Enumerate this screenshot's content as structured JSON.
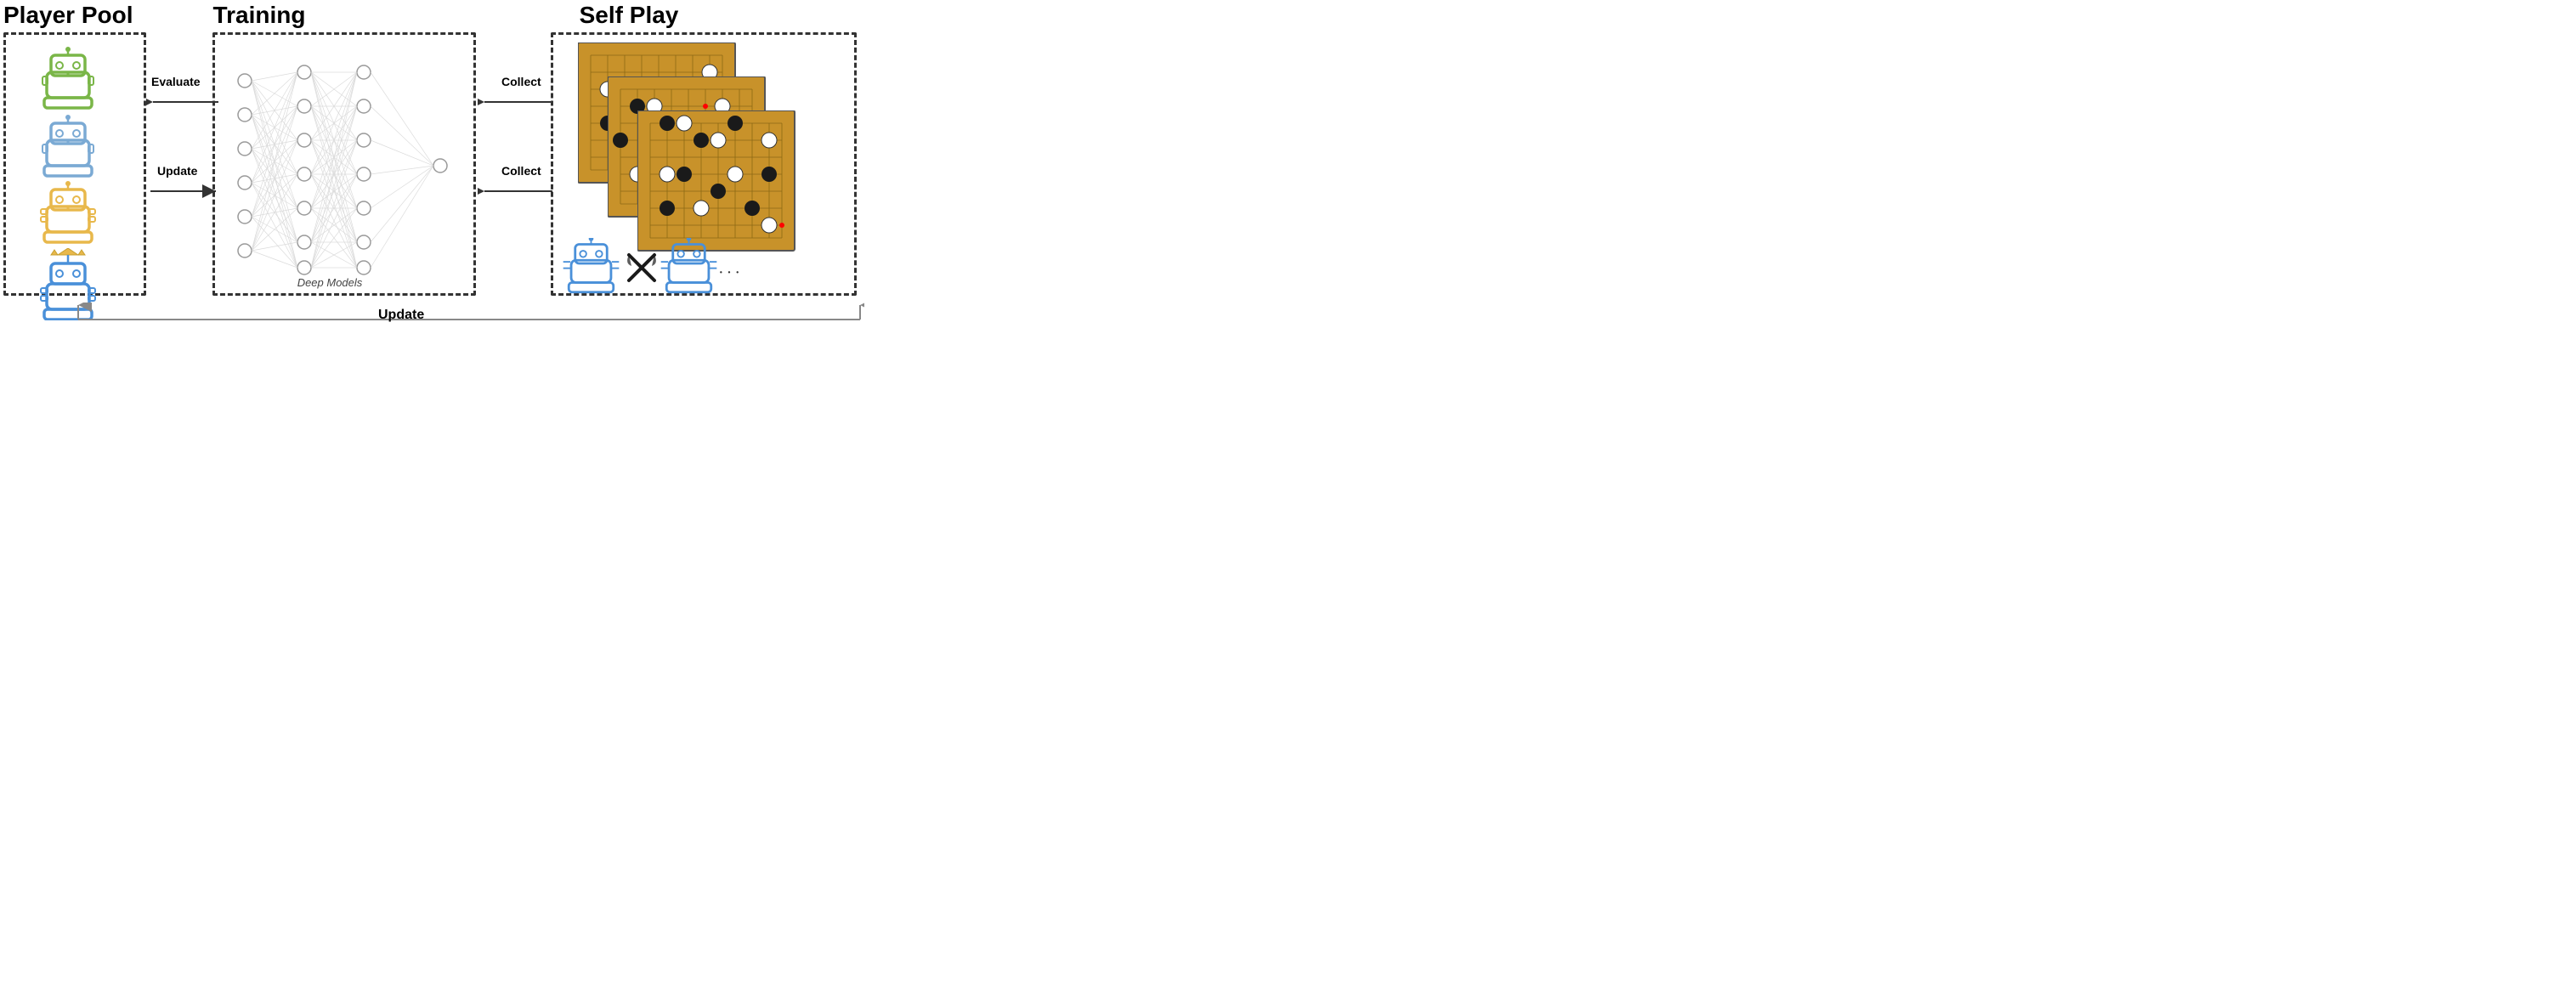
{
  "titles": {
    "player_pool": "Player Pool",
    "training": "Training",
    "self_play": "Self Play"
  },
  "arrows": {
    "evaluate_label": "Evaluate",
    "update_label": "Update",
    "collect1_label": "Collect",
    "collect2_label": "Collect",
    "bottom_update_label": "Update"
  },
  "neural_net": {
    "label": "Deep Models"
  },
  "robots": [
    {
      "color": "#7ab648",
      "label": "green-robot"
    },
    {
      "color": "#7baad4",
      "label": "blue-robot"
    },
    {
      "color": "#e8b84b",
      "label": "yellow-robot"
    },
    {
      "color": "#4a90d9",
      "label": "blue-crown-robot"
    }
  ]
}
